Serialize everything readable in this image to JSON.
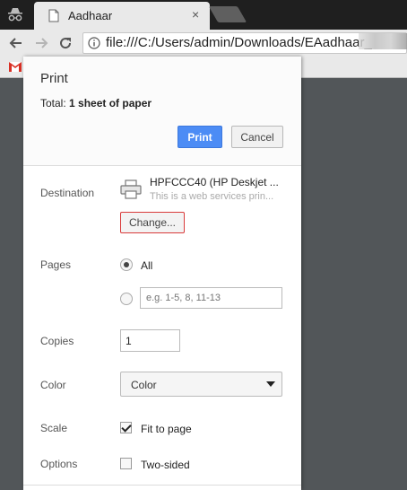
{
  "browser": {
    "tab_title": "Aadhaar",
    "close_glyph": "×",
    "url": "file:///C:/Users/admin/Downloads/EAadhaar_"
  },
  "print": {
    "title": "Print",
    "total_label": "Total: ",
    "total_value": "1 sheet of paper",
    "print_button": "Print",
    "cancel_button": "Cancel",
    "destination_label": "Destination",
    "printer_name": "HPFCCC40 (HP Deskjet ...",
    "printer_desc": "This is a web services prin...",
    "change_button": "Change...",
    "pages_label": "Pages",
    "pages_all": "All",
    "pages_all_selected": true,
    "pages_placeholder": "e.g. 1-5, 8, 11-13",
    "copies_label": "Copies",
    "copies_value": "1",
    "color_label": "Color",
    "color_value": "Color",
    "scale_label": "Scale",
    "fit_to_page": "Fit to page",
    "fit_to_page_checked": true,
    "options_label": "Options",
    "two_sided": "Two-sided",
    "two_sided_checked": false
  },
  "colors": {
    "accent": "#4c8cf5",
    "change_border": "#d93b3b",
    "page_background": "#525659"
  },
  "icons": [
    "incognito-icon",
    "page-icon",
    "back-icon",
    "forward-icon",
    "reload-icon",
    "info-icon",
    "gmail-icon",
    "printer-icon"
  ]
}
